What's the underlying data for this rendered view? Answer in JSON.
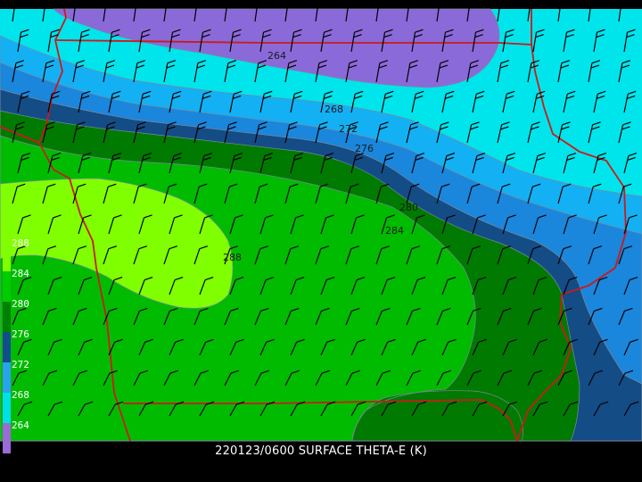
{
  "map": {
    "title": "220123/0600 SURFACE THETA-E (K)",
    "contour_labels": [
      "264",
      "268",
      "272",
      "276",
      "280",
      "284",
      "288"
    ],
    "legend": {
      "labels": [
        "288",
        "284",
        "280",
        "276",
        "272",
        "268",
        "264"
      ],
      "colors": [
        "#80ff00",
        "#00cc00",
        "#008000",
        "#114d8c",
        "#2aa2f0",
        "#00e0e8",
        "#9a6ad6"
      ]
    },
    "fill_colors": {
      "band_lt_264": "#8a6ad8",
      "band_264_268": "#00e4ec",
      "band_268_272": "#14b0f4",
      "band_272_276": "#1a86dc",
      "band_276_280": "#144c86",
      "band_280_284": "#007a00",
      "band_284_288": "#00bb00",
      "band_gt_288": "#80ff00",
      "state_border": "#cc1a1a",
      "wind_barb": "#000000"
    },
    "wind_barbs": "surface wind barbs"
  }
}
